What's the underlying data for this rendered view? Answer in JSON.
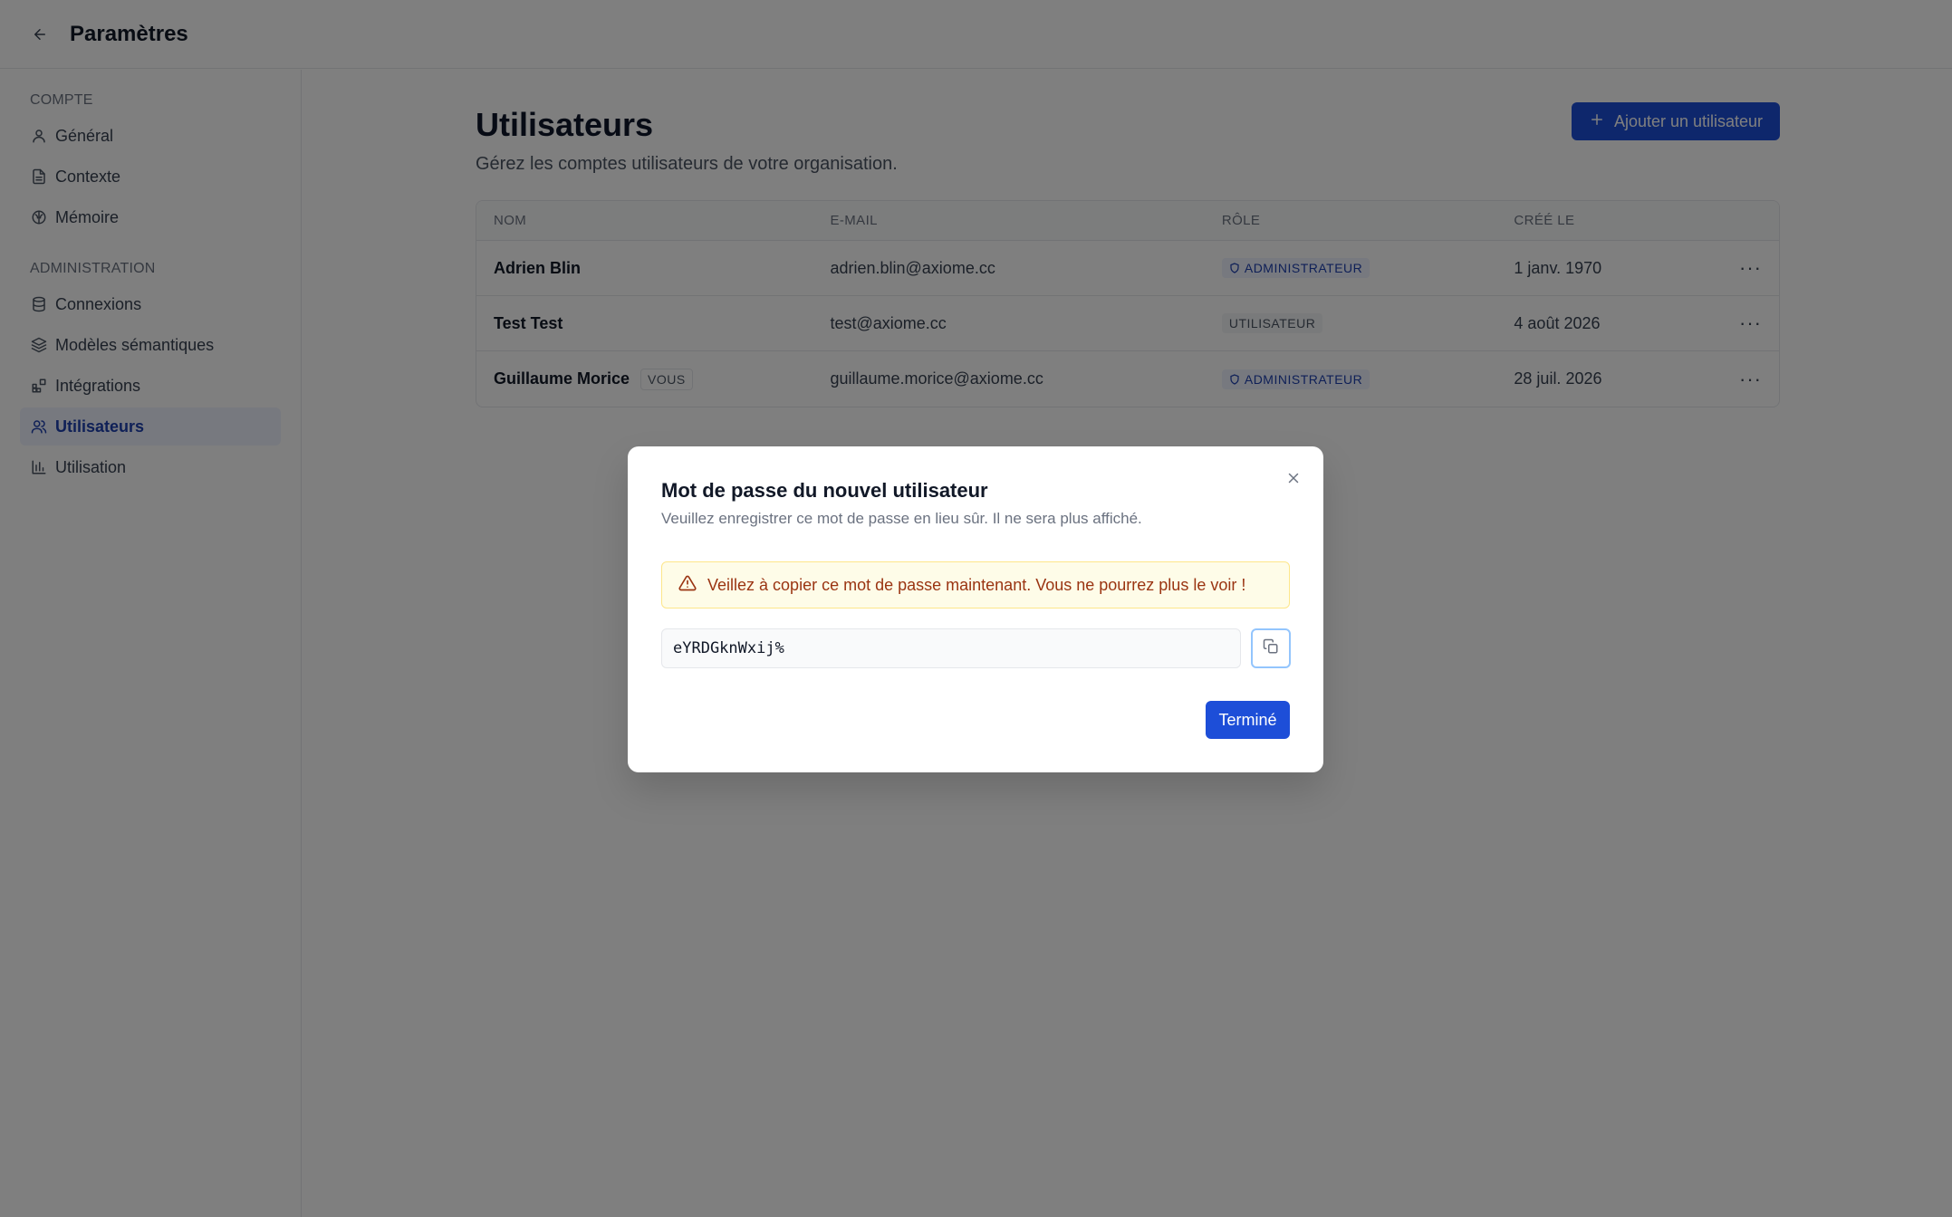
{
  "header": {
    "title": "Paramètres",
    "back_icon": "arrow-left-icon"
  },
  "sidebar": {
    "sections": [
      {
        "label": "COMPTE",
        "items": [
          {
            "label": "Général",
            "icon": "user-icon"
          },
          {
            "label": "Contexte",
            "icon": "file-text-icon"
          },
          {
            "label": "Mémoire",
            "icon": "brain-icon"
          }
        ]
      },
      {
        "label": "ADMINISTRATION",
        "items": [
          {
            "label": "Connexions",
            "icon": "database-icon"
          },
          {
            "label": "Modèles sémantiques",
            "icon": "layers-icon"
          },
          {
            "label": "Intégrations",
            "icon": "blocks-icon"
          },
          {
            "label": "Utilisateurs",
            "icon": "users-icon",
            "active": true
          },
          {
            "label": "Utilisation",
            "icon": "bar-chart-icon"
          }
        ]
      }
    ]
  },
  "main": {
    "title": "Utilisateurs",
    "subtitle": "Gérez les comptes utilisateurs de votre organisation.",
    "add_button": "Ajouter un utilisateur",
    "table": {
      "headers": [
        "NOM",
        "E-MAIL",
        "RÔLE",
        "CRÉÉ LE"
      ],
      "rows": [
        {
          "name": "Adrien Blin",
          "badge": "",
          "email": "adrien.blin@axiome.cc",
          "role": "ADMINISTRATEUR",
          "role_type": "admin",
          "created": "1 janv. 1970"
        },
        {
          "name": "Test Test",
          "badge": "",
          "email": "test@axiome.cc",
          "role": "UTILISATEUR",
          "role_type": "user",
          "created": "4 août 2026"
        },
        {
          "name": "Guillaume Morice",
          "badge": "VOUS",
          "email": "guillaume.morice@axiome.cc",
          "role": "ADMINISTRATEUR",
          "role_type": "admin",
          "created": "28 juil. 2026"
        }
      ]
    }
  },
  "modal": {
    "title": "Mot de passe du nouvel utilisateur",
    "description": "Veuillez enregistrer ce mot de passe en lieu sûr. Il ne sera plus affiché.",
    "warning": "Veillez à copier ce mot de passe maintenant. Vous ne pourrez plus le voir !",
    "password": "eYRDGknWxij%",
    "done_button": "Terminé"
  },
  "colors": {
    "accent": "#1d4ed8",
    "warning_bg": "#fefce8",
    "warning_text": "#9a3412"
  }
}
